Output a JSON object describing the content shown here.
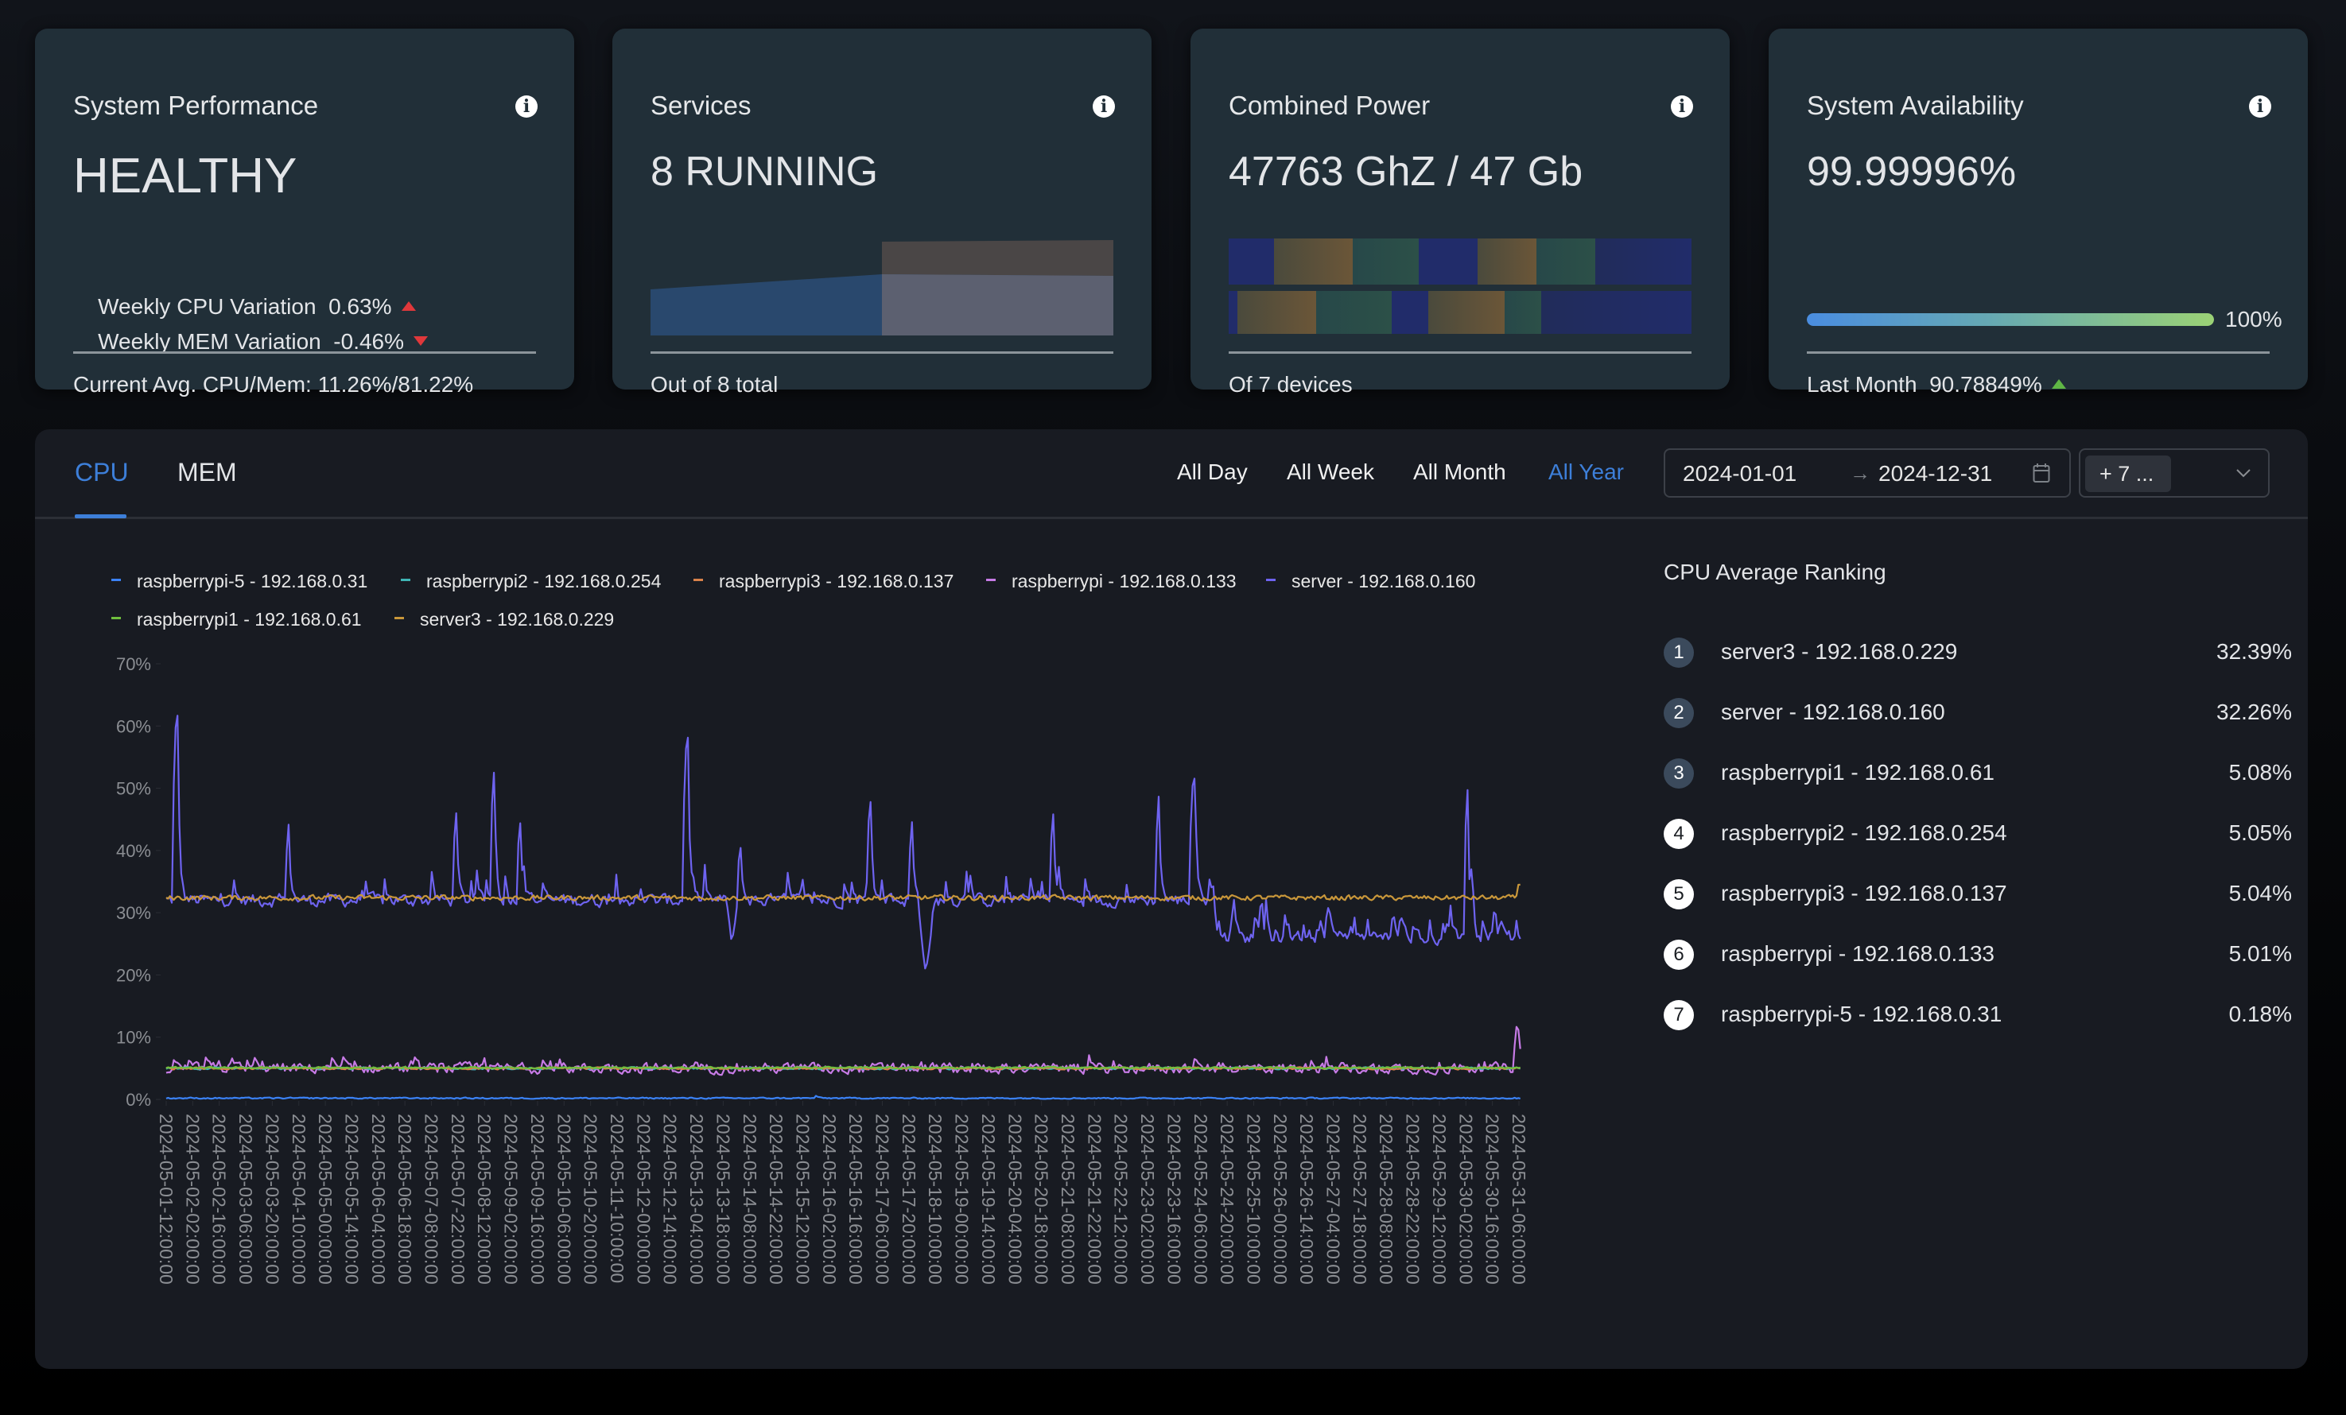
{
  "cards": {
    "performance": {
      "title": "System Performance",
      "status": "HEALTHY",
      "cpu_variation_label": "Weekly CPU Variation",
      "cpu_variation_value": "0.63%",
      "cpu_variation_trend": "up",
      "mem_variation_label": "Weekly MEM Variation",
      "mem_variation_value": "-0.46%",
      "mem_variation_trend": "down",
      "footer": "Current Avg. CPU/Mem: 11.26%/81.22%"
    },
    "services": {
      "title": "Services",
      "value": "8 RUNNING",
      "footer": "Out of 8 total"
    },
    "power": {
      "title": "Combined Power",
      "value": "47763 GhZ / 47 Gb",
      "footer": "Of 7 devices"
    },
    "availability": {
      "title": "System Availability",
      "value": "99.99996%",
      "progress_percent": 100,
      "progress_label": "100%",
      "footer_label": "Last Month",
      "footer_value": "90.78849%",
      "footer_trend": "up"
    }
  },
  "colors": {
    "accent": "#3d7fd9",
    "trend_down_red": "#e0383b",
    "trend_up_green": "#5fb645",
    "card_bg": "#212f38",
    "panel_bg": "#181b22"
  },
  "tabs": [
    {
      "label": "CPU",
      "active": true
    },
    {
      "label": "MEM",
      "active": false
    }
  ],
  "range_buttons": [
    {
      "label": "All Day",
      "active": false
    },
    {
      "label": "All Week",
      "active": false
    },
    {
      "label": "All Month",
      "active": false
    },
    {
      "label": "All Year",
      "active": true
    }
  ],
  "date_range": {
    "start": "2024-01-01",
    "separator": "→",
    "end": "2024-12-31"
  },
  "device_select": {
    "tag": "+ 7 ..."
  },
  "ranking": {
    "title": "CPU Average Ranking",
    "items": [
      {
        "rank": "1",
        "name": "server3 - 192.168.0.229",
        "value": "32.39%"
      },
      {
        "rank": "2",
        "name": "server - 192.168.0.160",
        "value": "32.26%"
      },
      {
        "rank": "3",
        "name": "raspberrypi1 - 192.168.0.61",
        "value": "5.08%"
      },
      {
        "rank": "4",
        "name": "raspberrypi2 - 192.168.0.254",
        "value": "5.05%"
      },
      {
        "rank": "5",
        "name": "raspberrypi3 - 192.168.0.137",
        "value": "5.04%"
      },
      {
        "rank": "6",
        "name": "raspberrypi - 192.168.0.133",
        "value": "5.01%"
      },
      {
        "rank": "7",
        "name": "raspberrypi-5 - 192.168.0.31",
        "value": "0.18%"
      }
    ]
  },
  "chart_data": {
    "type": "line",
    "title": "",
    "xlabel": "",
    "ylabel": "",
    "ylim": [
      0,
      70
    ],
    "y_ticks": [
      "0%",
      "10%",
      "20%",
      "30%",
      "40%",
      "50%",
      "60%",
      "70%"
    ],
    "grid": false,
    "legend_position": "top-left",
    "x_tick_labels": [
      "2024-05-01-12:00:00",
      "2024-05-02-02:00:00",
      "2024-05-02-16:00:00",
      "2024-05-03-06:00:00",
      "2024-05-03-20:00:00",
      "2024-05-04-10:00:00",
      "2024-05-05-00:00:00",
      "2024-05-05-14:00:00",
      "2024-05-06-04:00:00",
      "2024-05-06-18:00:00",
      "2024-05-07-08:00:00",
      "2024-05-07-22:00:00",
      "2024-05-08-12:00:00",
      "2024-05-09-02:00:00",
      "2024-05-09-16:00:00",
      "2024-05-10-06:00:00",
      "2024-05-10-20:00:00",
      "2024-05-11-10:00:00",
      "2024-05-12-00:00:00",
      "2024-05-12-14:00:00",
      "2024-05-13-04:00:00",
      "2024-05-13-18:00:00",
      "2024-05-14-08:00:00",
      "2024-05-14-22:00:00",
      "2024-05-15-12:00:00",
      "2024-05-16-02:00:00",
      "2024-05-16-16:00:00",
      "2024-05-17-06:00:00",
      "2024-05-17-20:00:00",
      "2024-05-18-10:00:00",
      "2024-05-19-00:00:00",
      "2024-05-19-14:00:00",
      "2024-05-20-04:00:00",
      "2024-05-20-18:00:00",
      "2024-05-21-08:00:00",
      "2024-05-21-22:00:00",
      "2024-05-22-12:00:00",
      "2024-05-23-02:00:00",
      "2024-05-23-16:00:00",
      "2024-05-24-06:00:00",
      "2024-05-24-20:00:00",
      "2024-05-25-10:00:00",
      "2024-05-26-00:00:00",
      "2024-05-26-14:00:00",
      "2024-05-27-04:00:00",
      "2024-05-27-18:00:00",
      "2024-05-28-08:00:00",
      "2024-05-28-22:00:00",
      "2024-05-29-12:00:00",
      "2024-05-30-02:00:00",
      "2024-05-30-16:00:00",
      "2024-05-31-06:00:00"
    ],
    "series": [
      {
        "name": "raspberrypi-5 - 192.168.0.31",
        "color": "#3b82f6",
        "baseline": 0.2,
        "noise": 0.15,
        "values_approx": {
          "typical": 0.2,
          "spikes": [
            [
              24.5,
              1.0
            ],
            [
              51.0,
              0.9
            ]
          ]
        }
      },
      {
        "name": "raspberrypi2 - 192.168.0.254",
        "color": "#3fb5b5",
        "baseline": 5.0,
        "noise": 0.25,
        "values_approx": {
          "typical": 5.0,
          "spikes": []
        }
      },
      {
        "name": "raspberrypi3 - 192.168.0.137",
        "color": "#d9824a",
        "baseline": 5.0,
        "noise": 0.25,
        "values_approx": {
          "typical": 5.0,
          "spikes": []
        }
      },
      {
        "name": "raspberrypi - 192.168.0.133",
        "color": "#c77be6",
        "baseline": 5.0,
        "noise": 1.2,
        "values_approx": {
          "typical": 5.0,
          "spikes": [
            [
              0.3,
              8.0
            ],
            [
              1.5,
              8.2
            ],
            [
              50.9,
              14.0
            ]
          ]
        }
      },
      {
        "name": "server - 192.168.0.160",
        "color": "#6e63f0",
        "baseline": 32.0,
        "noise": 1.5,
        "values_approx": {
          "typical": 32.0,
          "late_typical": 26.0,
          "spikes": [
            [
              0.35,
              66.0
            ],
            [
              4.6,
              47.5
            ],
            [
              10.9,
              50.0
            ],
            [
              12.3,
              58.0
            ],
            [
              13.3,
              48.5
            ],
            [
              19.6,
              62.0
            ],
            [
              21.6,
              44.0
            ],
            [
              26.5,
              52.0
            ],
            [
              28.1,
              48.0
            ],
            [
              33.4,
              50.0
            ],
            [
              37.4,
              53.0
            ],
            [
              38.7,
              55.0
            ],
            [
              49.0,
              56.0
            ]
          ],
          "dips": [
            [
              21.3,
              24.0
            ],
            [
              28.6,
              19.0
            ]
          ]
        }
      },
      {
        "name": "raspberrypi1 - 192.168.0.61",
        "color": "#6fbf3d",
        "baseline": 5.1,
        "noise": 0.2,
        "values_approx": {
          "typical": 5.1,
          "spikes": []
        }
      },
      {
        "name": "server3 - 192.168.0.229",
        "color": "#c9973a",
        "baseline": 32.4,
        "noise": 0.6,
        "values_approx": {
          "typical": 32.4,
          "spikes": [
            [
              51.0,
              36.5
            ]
          ]
        }
      }
    ]
  }
}
